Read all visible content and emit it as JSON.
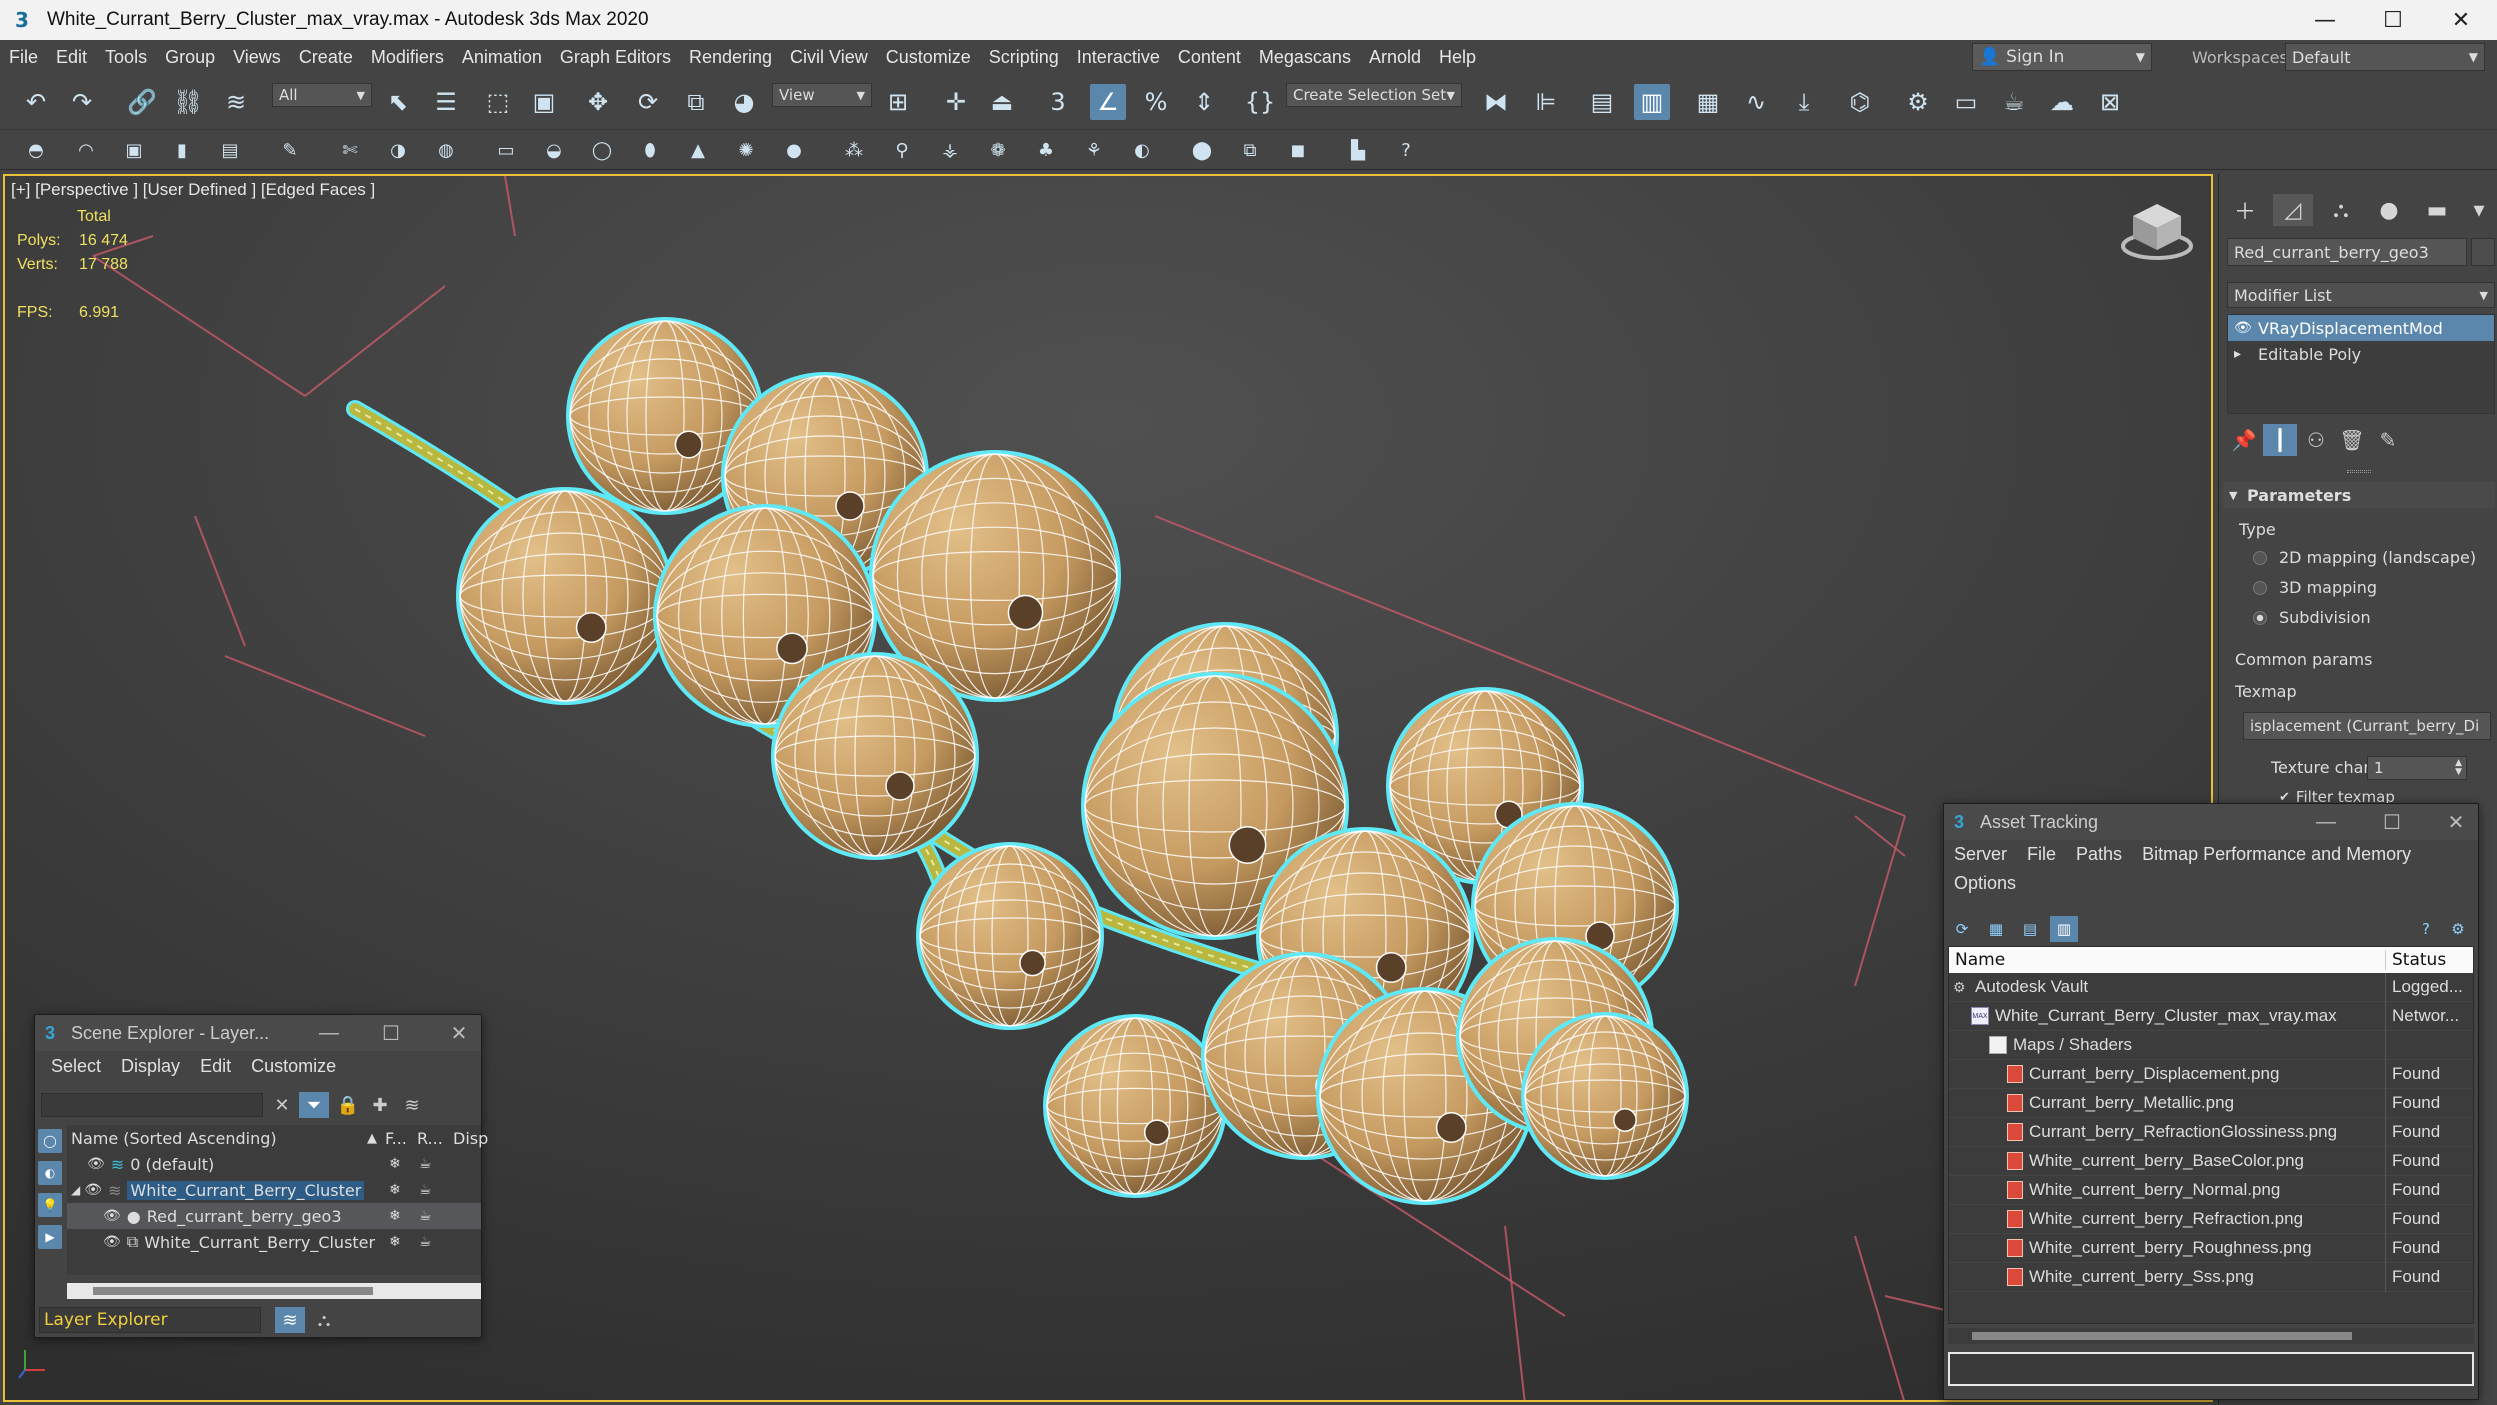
{
  "window": {
    "title": "White_Currant_Berry_Cluster_max_vray.max - Autodesk 3ds Max 2020",
    "minimize": "—",
    "maximize": "☐",
    "close": "✕"
  },
  "menubar": {
    "items": [
      "File",
      "Edit",
      "Tools",
      "Group",
      "Views",
      "Create",
      "Modifiers",
      "Animation",
      "Graph Editors",
      "Rendering",
      "Civil View",
      "Customize",
      "Scripting",
      "Interactive",
      "Content",
      "Megascans",
      "Arnold",
      "Help"
    ],
    "sign_in": "Sign In",
    "workspaces_label": "Workspaces:",
    "workspace_value": "Default"
  },
  "toolbar": {
    "selection_filter": "All",
    "reference_coord": "View",
    "selection_set": "Create Selection Set",
    "snap_label": "3"
  },
  "viewport": {
    "label": "[+] [Perspective ] [User Defined ] [Edged Faces ]",
    "stats": {
      "total_label": "Total",
      "polys_label": "Polys:",
      "polys_value": "16 474",
      "verts_label": "Verts:",
      "verts_value": "17 788",
      "fps_label": "FPS:",
      "fps_value": "6.991"
    },
    "colors": {
      "berry": "#c9a06a",
      "outline": "#5fe8f5",
      "wire": "#ffffff",
      "stem": "#b8b840",
      "grid": "#c85a6a"
    }
  },
  "command_panel": {
    "object_name": "Red_currant_berry_geo3",
    "modifier_list": "Modifier List",
    "stack": [
      {
        "label": "VRayDisplacementMod",
        "selected": true
      },
      {
        "label": "Editable Poly",
        "selected": false
      }
    ],
    "parameters": {
      "title": "Parameters",
      "type_label": "Type",
      "options": [
        {
          "label": "2D mapping (landscape)",
          "checked": false
        },
        {
          "label": "3D mapping",
          "checked": false
        },
        {
          "label": "Subdivision",
          "checked": true
        }
      ],
      "common_params": "Common params",
      "texmap_label": "Texmap",
      "texmap_value": "isplacement (Currant_berry_Di",
      "texture_chan_label": "Texture chan",
      "texture_chan_value": "1",
      "filter_texmap": "Filter texmap"
    }
  },
  "scene_explorer": {
    "title": "Scene Explorer - Layer...",
    "menu": [
      "Select",
      "Display",
      "Edit",
      "Customize"
    ],
    "columns": {
      "name": "Name (Sorted Ascending)",
      "freeze": "F...",
      "render": "R...",
      "display": "Disp"
    },
    "rows": [
      {
        "name": "0 (default)",
        "indent": 0,
        "selected": false,
        "expanded": false
      },
      {
        "name": "White_Currant_Berry_Cluster",
        "indent": 0,
        "selected": false,
        "expanded": true,
        "highlighted": true
      },
      {
        "name": "Red_currant_berry_geo3",
        "indent": 1,
        "selected": true,
        "expanded": false
      },
      {
        "name": "White_Currant_Berry_Cluster",
        "indent": 1,
        "selected": false,
        "expanded": false
      }
    ],
    "mode": "Layer Explorer"
  },
  "asset_tracking": {
    "title": "Asset Tracking",
    "menu": [
      "Server",
      "File",
      "Paths",
      "Bitmap Performance and Memory",
      "Options"
    ],
    "columns": {
      "name": "Name",
      "status": "Status"
    },
    "rows": [
      {
        "name": "Autodesk Vault",
        "status": "Logged...",
        "indent": 0,
        "icon": "vault"
      },
      {
        "name": "White_Currant_Berry_Cluster_max_vray.max",
        "status": "Networ...",
        "indent": 1,
        "icon": "max"
      },
      {
        "name": "Maps / Shaders",
        "status": "",
        "indent": 2,
        "icon": "folder"
      },
      {
        "name": "Currant_berry_Displacement.png",
        "status": "Found",
        "indent": 3,
        "icon": "file"
      },
      {
        "name": "Currant_berry_Metallic.png",
        "status": "Found",
        "indent": 3,
        "icon": "file"
      },
      {
        "name": "Currant_berry_RefractionGlossiness.png",
        "status": "Found",
        "indent": 3,
        "icon": "file"
      },
      {
        "name": "White_current_berry_BaseColor.png",
        "status": "Found",
        "indent": 3,
        "icon": "file"
      },
      {
        "name": "White_current_berry_Normal.png",
        "status": "Found",
        "indent": 3,
        "icon": "file"
      },
      {
        "name": "White_current_berry_Refraction.png",
        "status": "Found",
        "indent": 3,
        "icon": "file"
      },
      {
        "name": "White_current_berry_Roughness.png",
        "status": "Found",
        "indent": 3,
        "icon": "file"
      },
      {
        "name": "White_current_berry_Sss.png",
        "status": "Found",
        "indent": 3,
        "icon": "file"
      }
    ]
  }
}
